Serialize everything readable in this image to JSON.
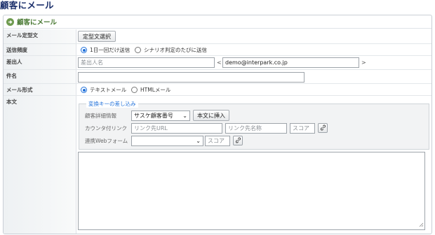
{
  "page": {
    "title": "顧客にメール"
  },
  "panel": {
    "title": "顧客にメール",
    "icon": "arrow-right-circle-icon",
    "accent": "#6f9b50"
  },
  "rows": {
    "template": {
      "label": "メール定型文",
      "button": "定型文選択"
    },
    "frequency": {
      "label": "送信頻度",
      "options": [
        "1日一回だけ送信",
        "シナリオ判定のたびに送信"
      ],
      "selected": "1日一回だけ送信"
    },
    "sender": {
      "label": "差出人",
      "name_placeholder": "差出人名",
      "open_bracket": "<",
      "email_value": "demo@interpark.co.jp",
      "close_bracket": ">"
    },
    "subject": {
      "label": "件名",
      "value": ""
    },
    "format": {
      "label": "メール形式",
      "options": [
        "テキストメール",
        "HTMLメール"
      ],
      "selected": "テキストメール"
    },
    "body": {
      "label": "本文",
      "legend": "変換キーの差し込み",
      "customer_label": "顧客詳細情報",
      "customer_select": "サスケ顧客番号",
      "insert_button": "本文に挿入",
      "counter_label": "カウンタ付リンク",
      "link_url_placeholder": "リンク先URL",
      "link_name_placeholder": "リンク先名称",
      "score_placeholder": "スコア",
      "webform_label": "連携Webフォーム",
      "webform_select": "",
      "webform_score_placeholder": "スコア",
      "link_icon": "link-icon",
      "content": ""
    }
  },
  "colors": {
    "title": "#1b2f6b",
    "radio": "#1e6fd9",
    "legend": "#1e6fd9"
  }
}
